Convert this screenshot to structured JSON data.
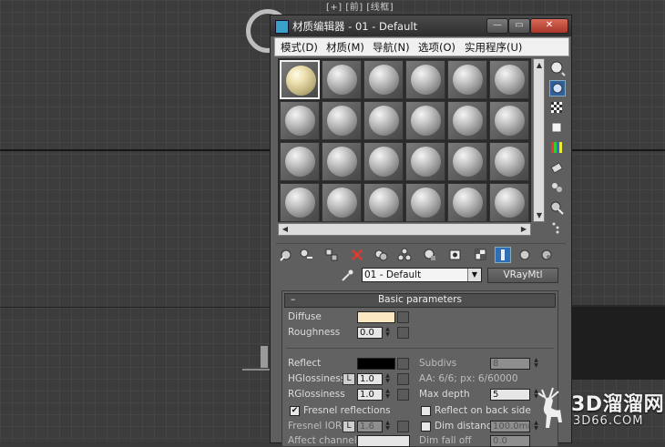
{
  "viewport": {
    "label": "[+] [前] [线框]"
  },
  "window": {
    "title": "材质编辑器 - 01 - Default",
    "buttons": {
      "minimize": "—",
      "maximize": "▭",
      "close": "✕"
    }
  },
  "menu": [
    {
      "label": "模式(D)"
    },
    {
      "label": "材质(M)"
    },
    {
      "label": "导航(N)"
    },
    {
      "label": "选项(O)"
    },
    {
      "label": "实用程序(U)"
    }
  ],
  "material": {
    "name": "01 - Default",
    "type": "VRayMtl"
  },
  "params": {
    "header": "Basic parameters",
    "header_collapse": "–",
    "diffuse_label": "Diffuse",
    "diffuse_color": "#fbe7c2",
    "roughness_label": "Roughness",
    "roughness_value": "0.0",
    "reflect_label": "Reflect",
    "reflect_color": "#000000",
    "subdivs_label": "Subdivs",
    "subdivs_value": "8",
    "hgloss_label": "HGlossiness",
    "hgloss_lock": "L",
    "hgloss_value": "1.0",
    "aa_label": "AA: 6/6; px: 6/60000",
    "rgloss_label": "RGlossiness",
    "rgloss_value": "1.0",
    "maxdepth_label": "Max depth",
    "maxdepth_value": "5",
    "fresnel_label": "Fresnel reflections",
    "fresnel_checked": "✔",
    "reflect_back_label": "Reflect on back side",
    "fresnel_ior_label": "Fresnel IOR",
    "fresnel_ior_lock": "L",
    "fresnel_ior_value": "1.6",
    "dim_distance_label": "Dim distance",
    "dim_distance_value": "100.0mm",
    "affect_channels_label": "Affect channels",
    "dim_falloff_label": "Dim fall off",
    "dim_falloff_value": "0.0"
  },
  "watermark": {
    "title": "3D溜溜网",
    "subtitle": "3D66.COM"
  }
}
